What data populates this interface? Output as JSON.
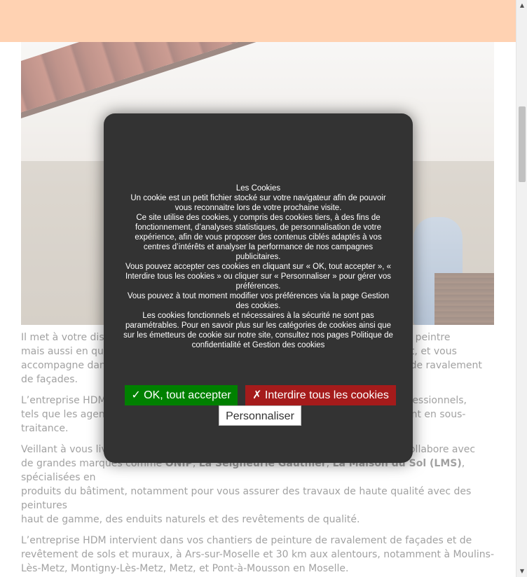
{
  "article": {
    "p1_a": "Il met à votre disp",
    "p1_b": "u’artisan peintre",
    "p1_c": "mais aussi en qua",
    "p1_d": "timent, et vous",
    "p1_e": "accompagne dans",
    "p1_f": "et de ravalement",
    "p1_g": "de façades.",
    "p2_a": "L’entreprise HDM",
    "p2_b": "professionnels,",
    "p2_c": "tels que les agenc",
    "p2_d": "âtiment en sous-",
    "p2_e": "traitance.",
    "p3_a": "Veillant à vous livr",
    "p3_b": ", collabore avec",
    "p3_c": "de grandes marques comme",
    "p3_onip": "ONIP",
    "p3_seign": "La Seigneurie Gauthier",
    "p3_sol": "La Maison du Sol (LMS)",
    "p3_d": ", spécialisées en",
    "p3_e": "produits du bâtiment, notamment pour vous assurer des travaux de haute qualité avec des peintures",
    "p3_f": "haut de gamme, des enduits naturels et des revêtements de qualité.",
    "p4": "L’entreprise HDM intervient dans vos chantiers de peinture de ravalement de façades et de revêtement de sols et muraux, à Ars-sur-Moselle et 30 km aux alentours, notamment à Moulins-Lès-Metz, Montigny-Lès-Metz, Metz, et Pont-à-Mousson en Moselle."
  },
  "cookie_modal": {
    "title": "Les Cookies",
    "para1": "Un cookie est un petit fichier stocké sur votre navigateur afin de pouvoir vous reconnaitre lors de votre prochaine visite.",
    "para2": "Ce site utilise des cookies, y compris des cookies tiers, à des fins de fonctionnement, d’analyses statistiques, de personnalisation de votre expérience, afin de vous proposer des contenus ciblés adaptés à vos centres d’intérêts et analyser la performance de nos campagnes publicitaires.",
    "para3": "Vous pouvez accepter ces cookies en cliquant sur « OK, tout accepter », « Interdire tous les cookies » ou cliquer sur « Personnaliser » pour gérer vos préférences.",
    "para4": "Vous pouvez à tout moment modifier vos préférences via la page Gestion des cookies.",
    "para5": "Les cookies fonctionnels et nécessaires à la sécurité ne sont pas paramétrables. Pour en savoir plus sur les catégories de cookies ainsi que sur les émetteurs de cookie sur notre site, consultez nos pages Politique de confidentialité et Gestion des cookies",
    "accept_label": "✓ OK, tout accepter",
    "deny_label": "✗ Interdire tous les cookies",
    "customize_label": "Personnaliser"
  },
  "colors": {
    "header": "#ffae73",
    "modal_bg": "#333333",
    "accept": "#008000",
    "deny": "#a51b1b"
  },
  "icons": {
    "scroll_up": "triangle-up-icon",
    "scroll_down": "triangle-down-icon"
  }
}
